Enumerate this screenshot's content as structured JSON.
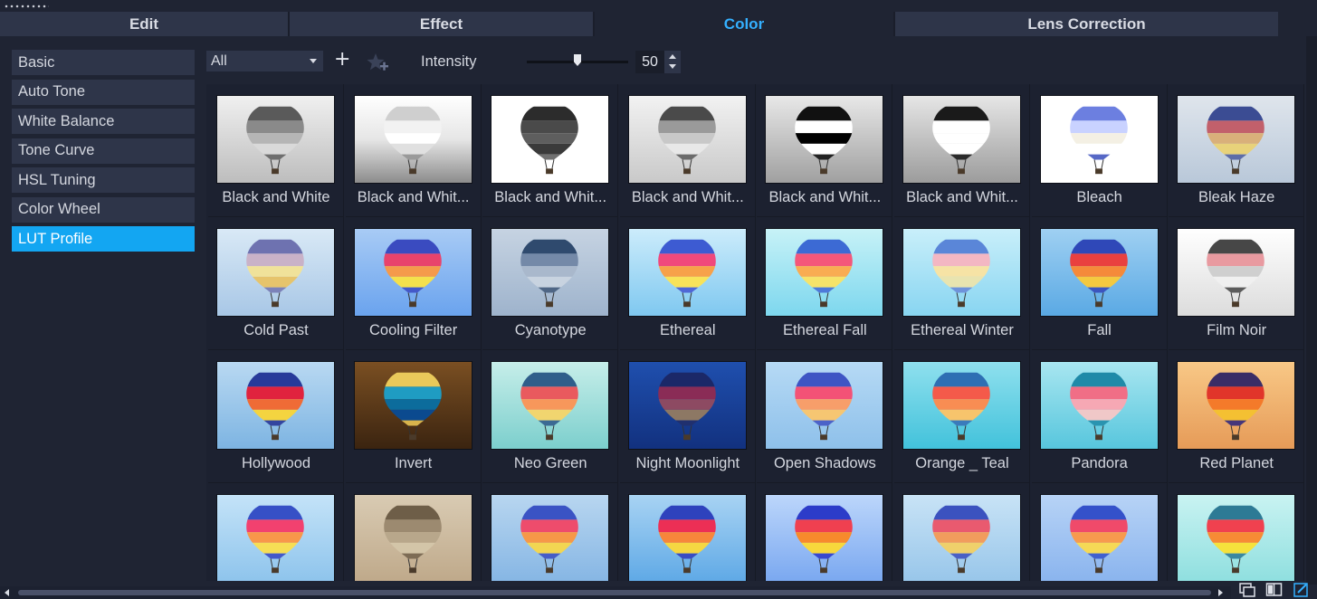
{
  "tabs": [
    {
      "label": "Edit",
      "active": false
    },
    {
      "label": "Effect",
      "active": false
    },
    {
      "label": "Color",
      "active": true
    },
    {
      "label": "Lens Correction",
      "active": false
    }
  ],
  "sidebar": {
    "items": [
      {
        "label": "Basic",
        "active": false
      },
      {
        "label": "Auto Tone",
        "active": false
      },
      {
        "label": "White Balance",
        "active": false
      },
      {
        "label": "Tone Curve",
        "active": false
      },
      {
        "label": "HSL Tuning",
        "active": false
      },
      {
        "label": "Color Wheel",
        "active": false
      },
      {
        "label": "LUT Profile",
        "active": true
      }
    ]
  },
  "toolbar": {
    "filter_value": "All",
    "add_icon": "plus-icon",
    "favorite_icon": "star-plus-icon",
    "intensity_label": "Intensity",
    "intensity_value": "50",
    "intensity_level": 0.5
  },
  "colors": {
    "accent": "#34b0ff",
    "active_item": "#13a6f2",
    "background": "#1f2433",
    "panel": "#2e3549"
  },
  "presets": [
    {
      "label": "Black and White",
      "bg": [
        "#f0f0f0",
        "#bdbdbd"
      ],
      "balloon": [
        "#5a5a5a",
        "#8a8a8a",
        "#b5b5b5",
        "#d9d9d9",
        "#6e6e6e"
      ]
    },
    {
      "label": "Black and Whit...",
      "bg": [
        "#ffffff",
        "#e6e6e6",
        "#8c8c8c"
      ],
      "balloon": [
        "#cfcfcf",
        "#f2f2f2",
        "#ffffff",
        "#e0e0e0",
        "#9a9a9a"
      ]
    },
    {
      "label": "Black and Whit...",
      "bg": [
        "#ffffff",
        "#ffffff"
      ],
      "balloon": [
        "#2c2c2c",
        "#4a4a4a",
        "#5e5e5e",
        "#3a3a3a",
        "#707070"
      ]
    },
    {
      "label": "Black and Whit...",
      "bg": [
        "#f2f2f2",
        "#c9c9c9"
      ],
      "balloon": [
        "#4a4a4a",
        "#9a9a9a",
        "#c8c8c8",
        "#e8e8e8",
        "#6b6b6b"
      ]
    },
    {
      "label": "Black and Whit...",
      "bg": [
        "#e8e8e8",
        "#a0a0a0"
      ],
      "balloon": [
        "#111111",
        "#ffffff",
        "#000000",
        "#ffffff",
        "#222222"
      ]
    },
    {
      "label": "Black and Whit...",
      "bg": [
        "#e6e6e6",
        "#9c9c9c"
      ],
      "balloon": [
        "#1a1a1a",
        "#ffffff",
        "#ffffff",
        "#ffffff",
        "#2a2a2a"
      ]
    },
    {
      "label": "Bleach",
      "bg": [
        "#ffffff",
        "#ffffff"
      ],
      "balloon": [
        "#6c7fe0",
        "#c9d2ff",
        "#f4f0e4",
        "#ffffff",
        "#5668c6"
      ]
    },
    {
      "label": "Bleak Haze",
      "bg": [
        "#dfe5ec",
        "#b9c8d9"
      ],
      "balloon": [
        "#3b4c93",
        "#c2606b",
        "#d9b07a",
        "#e8d27a",
        "#5d6da8"
      ]
    },
    {
      "label": "Cold Past",
      "bg": [
        "#d9e9f6",
        "#a8c7e6"
      ],
      "balloon": [
        "#6e72b0",
        "#c9b2c8",
        "#f0e29a",
        "#e6c46c",
        "#7c82b9"
      ]
    },
    {
      "label": "Cooling Filter",
      "bg": [
        "#a8cbf5",
        "#6aa3ee"
      ],
      "balloon": [
        "#3a4bc0",
        "#e8436c",
        "#f59a4b",
        "#f4e04c",
        "#4459c9"
      ]
    },
    {
      "label": "Cyanotype",
      "bg": [
        "#c6d3e2",
        "#9eb3cc"
      ],
      "balloon": [
        "#2f4a6e",
        "#7489a8",
        "#a9b8cc",
        "#c8d3e0",
        "#4f6685"
      ]
    },
    {
      "label": "Ethereal",
      "bg": [
        "#ccecfb",
        "#7fc8f0"
      ],
      "balloon": [
        "#3d5bd2",
        "#f0497c",
        "#f7a14a",
        "#f8e35a",
        "#4f67d6"
      ]
    },
    {
      "label": "Ethereal Fall",
      "bg": [
        "#c7f2f7",
        "#7dd7ee"
      ],
      "balloon": [
        "#3c6ad4",
        "#f4577a",
        "#f9ac52",
        "#f6e36a",
        "#4e7ad9"
      ]
    },
    {
      "label": "Ethereal Winter",
      "bg": [
        "#c9effa",
        "#88d5f1"
      ],
      "balloon": [
        "#5a86d8",
        "#f3b7c3",
        "#f6e3a5",
        "#e8e4b0",
        "#6f93db"
      ]
    },
    {
      "label": "Fall",
      "bg": [
        "#9fd0f2",
        "#5aa9e4"
      ],
      "balloon": [
        "#2f48b8",
        "#e9403f",
        "#f58a3a",
        "#f4c940",
        "#3c55bf"
      ]
    },
    {
      "label": "Film Noir",
      "bg": [
        "#ffffff",
        "#dcdcdc"
      ],
      "balloon": [
        "#474747",
        "#e89aa0",
        "#cfcfcf",
        "#f0f0f0",
        "#5c5c5c"
      ]
    },
    {
      "label": "Hollywood",
      "bg": [
        "#b9d9f2",
        "#7db4e2"
      ],
      "balloon": [
        "#273a9a",
        "#e0233e",
        "#ef6b36",
        "#f4d440",
        "#33459f"
      ]
    },
    {
      "label": "Invert",
      "bg": [
        "#7a4f22",
        "#3b2410"
      ],
      "balloon": [
        "#e9c95a",
        "#1f9cc2",
        "#0c6c9c",
        "#0b4a8f",
        "#d8b44c"
      ]
    },
    {
      "label": "Neo Green",
      "bg": [
        "#c6eee9",
        "#7ccfcd"
      ],
      "balloon": [
        "#2f5e8a",
        "#e95a5e",
        "#f7975b",
        "#f1d56f",
        "#3b6a93"
      ]
    },
    {
      "label": "Night Moonlight",
      "bg": [
        "#1f4fae",
        "#12317f"
      ],
      "balloon": [
        "#1b2868",
        "#8a2c56",
        "#8d4a62",
        "#8d7864",
        "#20306f"
      ]
    },
    {
      "label": "Open Shadows",
      "bg": [
        "#b6daf5",
        "#8ec0ea"
      ],
      "balloon": [
        "#3e55c4",
        "#f35276",
        "#f79e6a",
        "#f6c672",
        "#4c62c8"
      ]
    },
    {
      "label": "Orange _ Teal",
      "bg": [
        "#8fe0ee",
        "#42c2db"
      ],
      "balloon": [
        "#2e6fb3",
        "#f45a4a",
        "#f88d53",
        "#f7c46c",
        "#3a7bbb"
      ]
    },
    {
      "label": "Pandora",
      "bg": [
        "#a8e6f0",
        "#57c6dd"
      ],
      "balloon": [
        "#1f8aa8",
        "#f06e86",
        "#f6a8b4",
        "#f0c8c8",
        "#2a94b0"
      ]
    },
    {
      "label": "Red Planet",
      "bg": [
        "#f8c886",
        "#e69b58"
      ],
      "balloon": [
        "#3a2d66",
        "#e1352a",
        "#f47a2a",
        "#f4c032",
        "#46367a"
      ]
    },
    {
      "label": "",
      "bg": [
        "#c4e3f8",
        "#8ec4ec"
      ],
      "balloon": [
        "#3650c6",
        "#f2416f",
        "#f8974a",
        "#f6de55",
        "#4458c9"
      ]
    },
    {
      "label": "",
      "bg": [
        "#d9cbb3",
        "#bfa98a"
      ],
      "balloon": [
        "#6e5e48",
        "#9c8a70",
        "#b8a78b",
        "#d3c5a8",
        "#7d6c55"
      ]
    },
    {
      "label": "",
      "bg": [
        "#b8d6f0",
        "#86b6e4"
      ],
      "balloon": [
        "#3a53c4",
        "#ee4c6c",
        "#f69848",
        "#f2d652",
        "#465dc7"
      ]
    },
    {
      "label": "",
      "bg": [
        "#a8d3f3",
        "#5fa9e6"
      ],
      "balloon": [
        "#2e42bd",
        "#ec2f55",
        "#f7863b",
        "#f5d742",
        "#394cc2"
      ]
    },
    {
      "label": "",
      "bg": [
        "#bcd6fb",
        "#7aa8f0"
      ],
      "balloon": [
        "#2c3cc9",
        "#f04050",
        "#f78a2c",
        "#f7d83c",
        "#3848cf"
      ]
    },
    {
      "label": "",
      "bg": [
        "#c8e3f6",
        "#98c6ea"
      ],
      "balloon": [
        "#3b52bf",
        "#e95a6f",
        "#f19c5d",
        "#efd06b",
        "#4a60c4"
      ]
    },
    {
      "label": "",
      "bg": [
        "#b7d3f6",
        "#8ab4ee"
      ],
      "balloon": [
        "#3451ca",
        "#f04a6a",
        "#f79a4e",
        "#f5d956",
        "#4160cf"
      ]
    },
    {
      "label": "",
      "bg": [
        "#c9f3f2",
        "#8fdfdf"
      ],
      "balloon": [
        "#2d7a95",
        "#f0414f",
        "#f78b35",
        "#f5e23c",
        "#3a87a0"
      ]
    }
  ],
  "bottom": {
    "view_icons": [
      "list-view-icon",
      "grid-view-icon",
      "edit-icon"
    ]
  }
}
